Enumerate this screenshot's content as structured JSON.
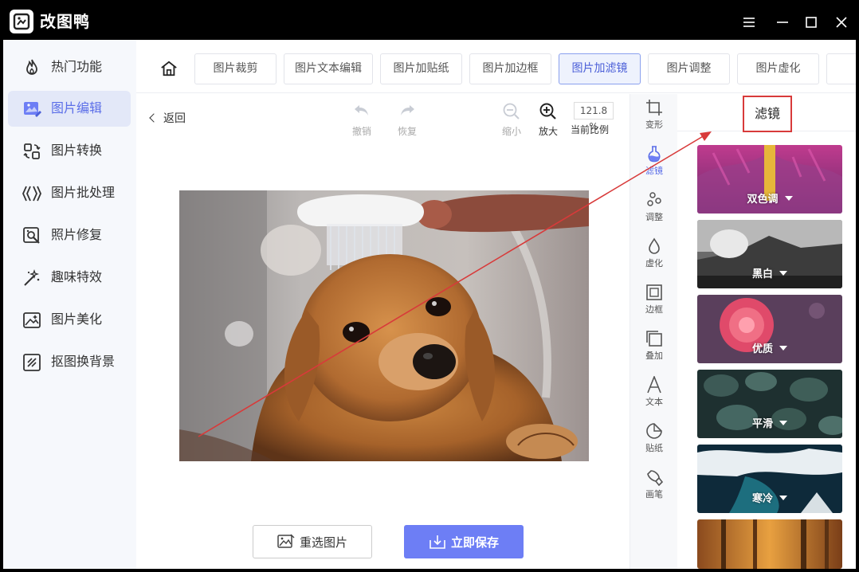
{
  "app": {
    "title": "改图鸭"
  },
  "window_controls": {
    "menu": "menu-icon",
    "minimize": "minimize-icon",
    "maximize": "maximize-icon",
    "close": "close-icon"
  },
  "sidebar": {
    "items": [
      {
        "label": "热门功能",
        "icon": "fire-icon"
      },
      {
        "label": "图片编辑",
        "icon": "image-edit-icon",
        "active": true
      },
      {
        "label": "图片转换",
        "icon": "convert-icon"
      },
      {
        "label": "图片批处理",
        "icon": "batch-icon"
      },
      {
        "label": "照片修复",
        "icon": "repair-icon"
      },
      {
        "label": "趣味特效",
        "icon": "magic-icon"
      },
      {
        "label": "图片美化",
        "icon": "beautify-icon"
      },
      {
        "label": "抠图换背景",
        "icon": "cutout-icon"
      }
    ]
  },
  "tabs": [
    {
      "label": "图片裁剪"
    },
    {
      "label": "图片文本编辑"
    },
    {
      "label": "图片加贴纸"
    },
    {
      "label": "图片加边框"
    },
    {
      "label": "图片加滤镜",
      "active": true
    },
    {
      "label": "图片调整"
    },
    {
      "label": "图片虚化"
    }
  ],
  "editor": {
    "back": "返回",
    "undo": "撤销",
    "redo": "恢复",
    "zoom_out": "缩小",
    "zoom_in": "放大",
    "zoom_value": "121.8 %",
    "zoom_label": "当前比例",
    "reselect": "重选图片",
    "save": "立即保存"
  },
  "right_tools": [
    {
      "label": "变形",
      "icon": "transform-icon"
    },
    {
      "label": "滤镜",
      "icon": "filter-icon",
      "active": true
    },
    {
      "label": "调整",
      "icon": "adjust-icon"
    },
    {
      "label": "虚化",
      "icon": "blur-icon"
    },
    {
      "label": "边框",
      "icon": "border-icon"
    },
    {
      "label": "叠加",
      "icon": "overlay-icon"
    },
    {
      "label": "文本",
      "icon": "text-icon"
    },
    {
      "label": "贴纸",
      "icon": "sticker-icon"
    },
    {
      "label": "画笔",
      "icon": "brush-icon"
    }
  ],
  "filter_panel": {
    "title": "滤镜",
    "filters": [
      {
        "label": "双色调"
      },
      {
        "label": "黑白"
      },
      {
        "label": "优质"
      },
      {
        "label": "平滑"
      },
      {
        "label": "寒冷"
      }
    ]
  },
  "colors": {
    "accent": "#6d7ef5",
    "annotation": "#d83a3a"
  }
}
